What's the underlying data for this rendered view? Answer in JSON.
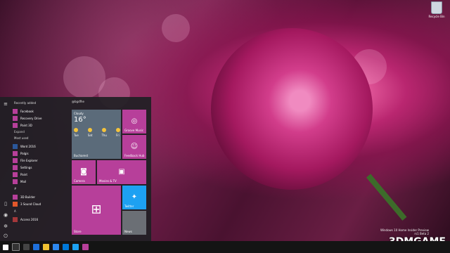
{
  "desktop": {
    "recycle_bin_label": "Recycle Bin",
    "watermark": {
      "line1": "Windows 10 Home Insider Preview",
      "line2": "rs1 Beta 2"
    },
    "brand": "3DMGAME"
  },
  "start_menu": {
    "accent": "#b73f9a",
    "recent_header": "Recently added",
    "recent": [
      {
        "label": "Facebook"
      },
      {
        "label": "Recovery Drive"
      },
      {
        "label": "Paint 3D"
      }
    ],
    "expand": "Expand",
    "most_used_header": "Most used",
    "most_used": [
      {
        "label": "Word 2016"
      },
      {
        "label": "Palgis"
      },
      {
        "label": "File Explorer"
      },
      {
        "label": "Settings"
      },
      {
        "label": "Paint"
      },
      {
        "label": "Mail"
      }
    ],
    "hash_header": "#",
    "hash_apps": [
      {
        "label": "3D Builder"
      },
      {
        "label": "3 Sound Cloud"
      }
    ],
    "a_header": "A",
    "a_apps": [
      {
        "label": "Access 2016"
      }
    ],
    "tiles_header": "@bgdfhe",
    "tiles": {
      "weather": {
        "condition": "Cloudy",
        "temp": "16°",
        "location": "Bucharest",
        "days": [
          "Tue",
          "Sat",
          "Thu",
          "Fri"
        ]
      },
      "groove": "Groove Music",
      "feedback": "Feedback Hub",
      "camera": "Camera",
      "movies": "Movies & TV",
      "store": "Store",
      "twitter": "Twitter",
      "news": "News"
    }
  },
  "taskbar": {
    "icons": [
      "start-icon",
      "search-icon",
      "task-view-icon",
      "edge-icon",
      "file-explorer-icon",
      "store-icon",
      "mail-icon",
      "twitter-icon",
      "app-icon"
    ]
  }
}
